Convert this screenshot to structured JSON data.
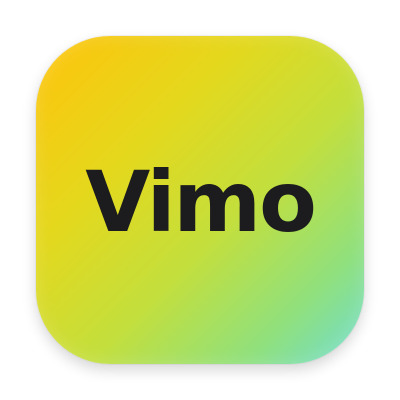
{
  "app_icon": {
    "name": "Vimo",
    "text_color": "#1c1c1e",
    "gradient": [
      "#ffc30a",
      "#e4d81d",
      "#c3df3d",
      "#8fe07e",
      "#70ddd3"
    ]
  }
}
